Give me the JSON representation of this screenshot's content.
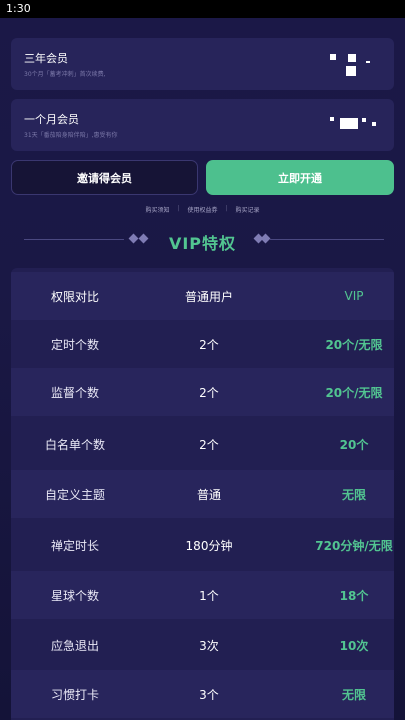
{
  "status_bar": {
    "time": "1:30"
  },
  "plans": [
    {
      "title": "三年会员",
      "desc": "30个月「蓄考冲刺」首次续费,"
    },
    {
      "title": "一个月会员",
      "desc": "31天「番茄陪身陪伴陪」,惠受有你"
    }
  ],
  "buttons": {
    "invite": "邀请得会员",
    "open": "立即开通"
  },
  "links": [
    "购买须知",
    "使用权益券",
    "购买记录"
  ],
  "vip_section": {
    "title": "VIP特权"
  },
  "table": {
    "headers": [
      "权限对比",
      "普通用户",
      "VIP"
    ],
    "rows": [
      [
        "定时个数",
        "2个",
        "20个/无限"
      ],
      [
        "监督个数",
        "2个",
        "20个/无限"
      ],
      [
        "白名单个数",
        "2个",
        "20个"
      ],
      [
        "自定义主题",
        "普通",
        "无限"
      ],
      [
        "禅定时长",
        "180分钟",
        "720分钟/无限"
      ],
      [
        "星球个数",
        "1个",
        "18个"
      ],
      [
        "应急退出",
        "3次",
        "10次"
      ],
      [
        "习惯打卡",
        "3个",
        "无限"
      ]
    ]
  },
  "colors": {
    "accent": "#4dc08e",
    "background": "#1b1847",
    "card": "#27245a"
  }
}
